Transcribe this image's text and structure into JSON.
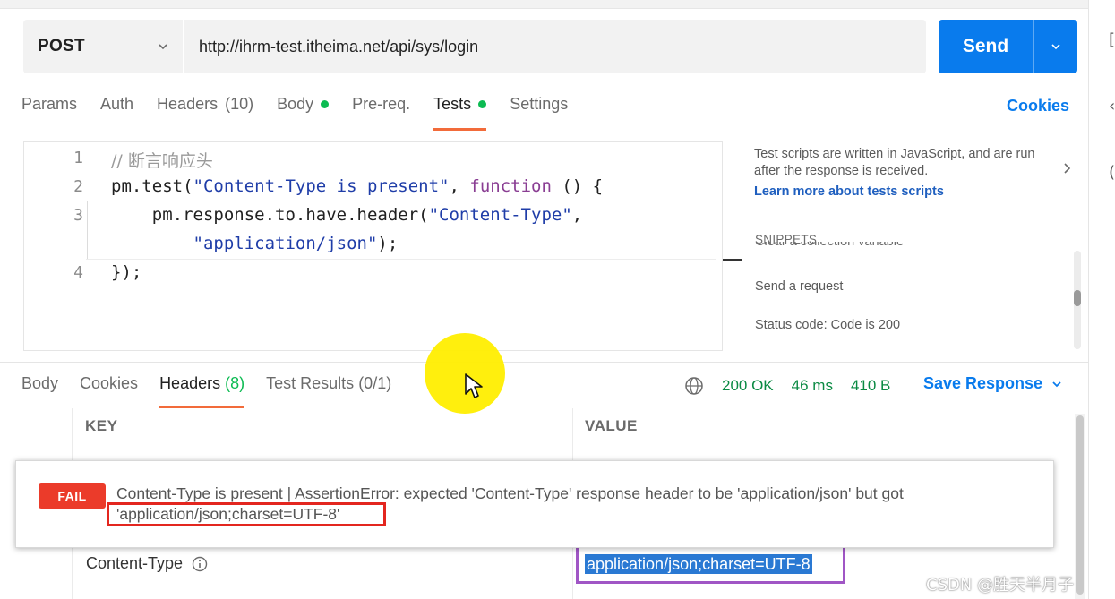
{
  "request": {
    "method": "POST",
    "url": "http://ihrm-test.itheima.net/api/sys/login",
    "send_label": "Send"
  },
  "req_tabs": [
    {
      "label": "Params",
      "count": "",
      "dot": false,
      "active": false
    },
    {
      "label": "Auth",
      "count": "",
      "dot": false,
      "active": false
    },
    {
      "label": "Headers",
      "count": "(10)",
      "dot": false,
      "active": false
    },
    {
      "label": "Body",
      "count": "",
      "dot": true,
      "active": false
    },
    {
      "label": "Pre-req.",
      "count": "",
      "dot": false,
      "active": false
    },
    {
      "label": "Tests",
      "count": "",
      "dot": true,
      "active": true
    },
    {
      "label": "Settings",
      "count": "",
      "dot": false,
      "active": false
    }
  ],
  "cookies_link": "Cookies",
  "editor": {
    "lines": [
      {
        "num": "1",
        "comment": "// 断言响应头"
      },
      {
        "num": "2",
        "pre": "pm.test(",
        "str": "\"Content-Type is present\"",
        "mid": ", ",
        "kw": "function",
        "post": " () {"
      },
      {
        "num": "3",
        "pre": "    pm.response.to.have.header(",
        "str": "\"Content-Type\"",
        "post": ","
      },
      {
        "num": "",
        "pre": "        ",
        "str": "\"application/json\"",
        "post": ");"
      },
      {
        "num": "4",
        "pre": "});"
      }
    ]
  },
  "side_panel": {
    "description": "Test scripts are written in JavaScript, and are run after the response is received.",
    "learn_more": "Learn more about tests scripts",
    "snippets_heading": "SNIPPETS",
    "snippet_partial": "Clear a collection variable",
    "snippets": [
      "Send a request",
      "Status code: Code is 200"
    ]
  },
  "resp_tabs": [
    {
      "label": "Body",
      "count": "",
      "active": false
    },
    {
      "label": "Cookies",
      "count": "",
      "active": false
    },
    {
      "label": "Headers",
      "count": "(8)",
      "active": true
    },
    {
      "label": "Test Results",
      "count": "(0/1)",
      "active": false
    }
  ],
  "response_meta": {
    "status": "200 OK",
    "time": "46 ms",
    "size": "410 B",
    "save_label": "Save Response"
  },
  "headers_table": {
    "columns": [
      "KEY",
      "VALUE"
    ],
    "rows": [
      {
        "key": "Content-Type",
        "value": "application/json;charset=UTF-8"
      }
    ]
  },
  "fail_popup": {
    "badge": "FAIL",
    "message_line1": "Content-Type is present | AssertionError: expected 'Content-Type' response header to be 'application/json' but got",
    "message_line2": "'application/json;charset=UTF-8'"
  },
  "watermark": "CSDN @胜天半月子",
  "colors": {
    "accent_blue": "#097bed",
    "tab_underline": "#f26b3a",
    "status_green": "#0a8a43",
    "fail_red": "#eb3b2a",
    "highlight_yellow": "#ffee00"
  }
}
